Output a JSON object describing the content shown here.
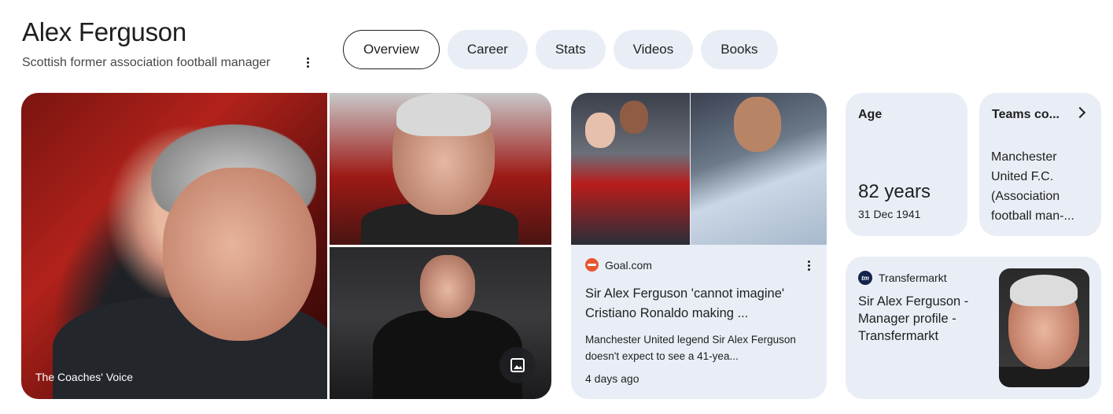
{
  "header": {
    "title": "Alex Ferguson",
    "subtitle": "Scottish former association football manager"
  },
  "tabs": [
    {
      "label": "Overview",
      "active": true
    },
    {
      "label": "Career",
      "active": false
    },
    {
      "label": "Stats",
      "active": false
    },
    {
      "label": "Videos",
      "active": false
    },
    {
      "label": "Books",
      "active": false
    }
  ],
  "images": {
    "main_caption": "The Coaches' Voice",
    "more_images_icon": "image-icon"
  },
  "news": {
    "source": "Goal.com",
    "headline": "Sir Alex Ferguson 'cannot imagine' Cristiano Ronaldo making ...",
    "snippet": "Manchester United legend Sir Alex Ferguson doesn't expect to see a 41-yea...",
    "time": "4 days ago"
  },
  "facts": {
    "age_label": "Age",
    "age_value": "82 years",
    "age_date": "31 Dec 1941",
    "teams_label": "Teams co...",
    "teams_value": "Manchester United F.C. (Association football man-..."
  },
  "profile": {
    "source": "Transfermarkt",
    "source_icon_text": "tm",
    "title": "Sir Alex Ferguson - Manager profile - Transfermarkt"
  },
  "colors": {
    "card_bg": "#e9eef6",
    "text": "#1f1f1f"
  }
}
